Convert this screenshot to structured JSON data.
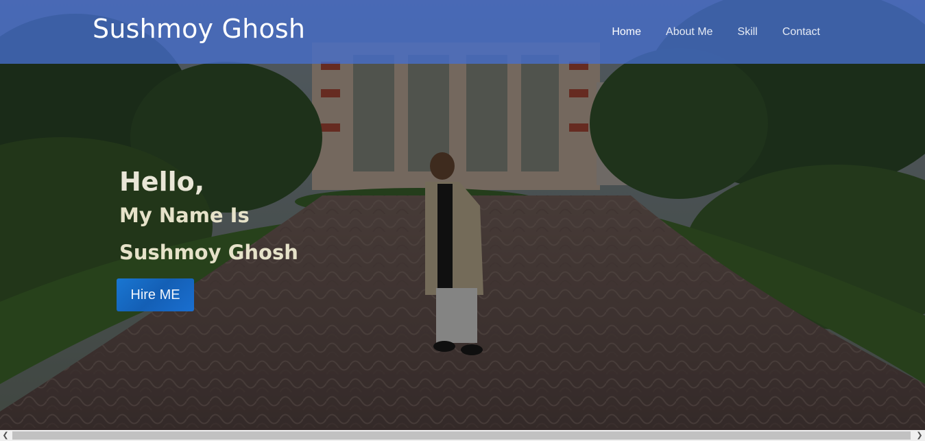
{
  "navbar": {
    "brand": "Sushmoy Ghosh",
    "links": [
      {
        "label": "Home",
        "active": true
      },
      {
        "label": "About Me",
        "active": false
      },
      {
        "label": "Skill",
        "active": false
      },
      {
        "label": "Contact",
        "active": false
      }
    ],
    "color": "#466ecd"
  },
  "hero": {
    "greeting": "Hello,",
    "intro": "My Name Is",
    "name": "Sushmoy Ghosh",
    "cta_label": "Hire ME",
    "cta_color": "#1565c0"
  },
  "scrollbar": {
    "left_arrow_icon": "chevron-left-icon",
    "right_arrow_icon": "chevron-right-icon"
  }
}
